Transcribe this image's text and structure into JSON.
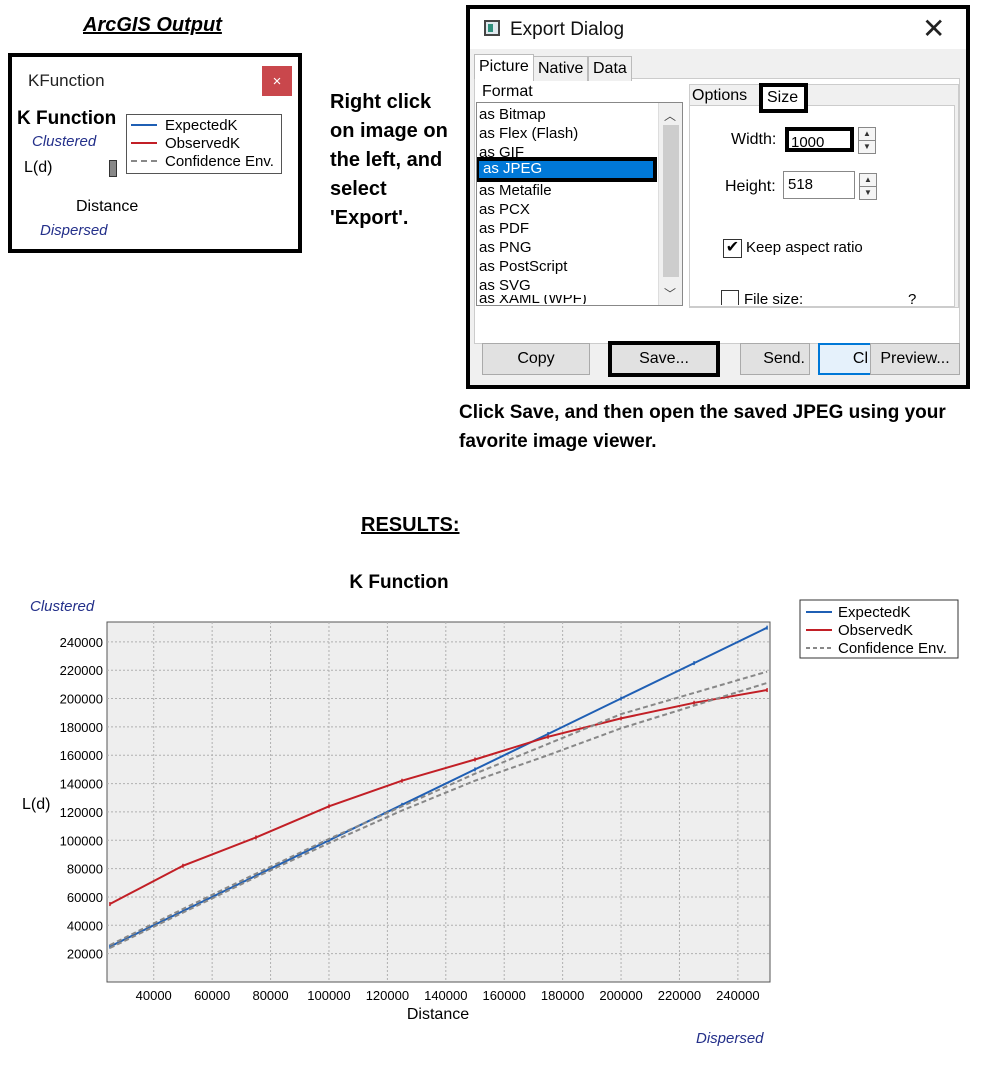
{
  "arcgis_heading": "ArcGIS Output",
  "kf_window": {
    "title": "KFunction",
    "close_glyph": "×",
    "chart_title": "K Function",
    "clustered": "Clustered",
    "ylabel": "L(d)",
    "xlabel": "Distance",
    "dispersed": "Dispersed",
    "legend": [
      "ExpectedK",
      "ObservedK",
      "Confidence Env."
    ]
  },
  "instruction_left": "Right click on image on the left, and select 'Export'.",
  "instruction_save": "Click Save, and then open the saved JPEG using your favorite image viewer.",
  "export_dialog": {
    "title": "Export Dialog",
    "close_glyph": "✕",
    "tabs": [
      "Picture",
      "Native",
      "Data"
    ],
    "format_label": "Format",
    "formats": [
      "as Bitmap",
      "as Flex (Flash)",
      "as GIF",
      "as JPEG",
      "as Metafile",
      "as PCX",
      "as PDF",
      "as PNG",
      "as PostScript",
      "as SVG",
      "as XAML (WPF)"
    ],
    "selected_format": "as JPEG",
    "option_tabs": [
      "Options",
      "Size"
    ],
    "width_label": "Width:",
    "width_value": "1000",
    "height_label": "Height:",
    "height_value": "518",
    "keep_aspect_label": "Keep aspect ratio",
    "keep_aspect_checked": true,
    "file_size_label": "File size:",
    "file_size_value": "?",
    "buttons": {
      "copy": "Copy",
      "save": "Save...",
      "send": "Send.",
      "close": "Cl",
      "preview": "Preview..."
    }
  },
  "results_heading": "RESULTS:",
  "chart_data": {
    "type": "line",
    "title": "K Function",
    "xlabel": "Distance",
    "ylabel": "L(d)",
    "top_label": "Clustered",
    "bottom_label": "Dispersed",
    "xlim": [
      24000,
      251000
    ],
    "ylim": [
      0,
      254000
    ],
    "x_ticks": [
      40000,
      60000,
      80000,
      100000,
      120000,
      140000,
      160000,
      180000,
      200000,
      220000,
      240000
    ],
    "y_ticks": [
      20000,
      40000,
      60000,
      80000,
      100000,
      120000,
      140000,
      160000,
      180000,
      200000,
      220000,
      240000
    ],
    "grid": true,
    "legend_position": "top-right",
    "series": [
      {
        "name": "ExpectedK",
        "color": "#1f5fb4",
        "style": "solid",
        "x": [
          25000,
          50000,
          75000,
          100000,
          125000,
          150000,
          175000,
          200000,
          225000,
          250000
        ],
        "y": [
          25000,
          50000,
          75000,
          100000,
          125000,
          150000,
          175000,
          200000,
          225000,
          250000
        ]
      },
      {
        "name": "ObservedK",
        "color": "#c21f26",
        "style": "solid",
        "x": [
          25000,
          50000,
          75000,
          100000,
          125000,
          150000,
          175000,
          200000,
          225000,
          250000
        ],
        "y": [
          55000,
          82000,
          102000,
          124000,
          142000,
          157000,
          173000,
          186000,
          197000,
          206000
        ]
      },
      {
        "name": "Confidence Env.",
        "color": "#888888",
        "style": "dashed",
        "x": [
          25000,
          50000,
          75000,
          100000,
          125000,
          150000,
          175000,
          200000,
          225000,
          250000
        ],
        "y": [
          26000,
          51500,
          76500,
          101000,
          124000,
          147000,
          168000,
          189000,
          204000,
          219000
        ]
      },
      {
        "name": "",
        "color": "#888888",
        "style": "dashed",
        "x": [
          25000,
          50000,
          75000,
          100000,
          125000,
          150000,
          175000,
          200000,
          225000,
          250000
        ],
        "y": [
          24000,
          49000,
          74000,
          98000,
          121000,
          142000,
          160000,
          179000,
          195000,
          211000
        ]
      }
    ]
  }
}
